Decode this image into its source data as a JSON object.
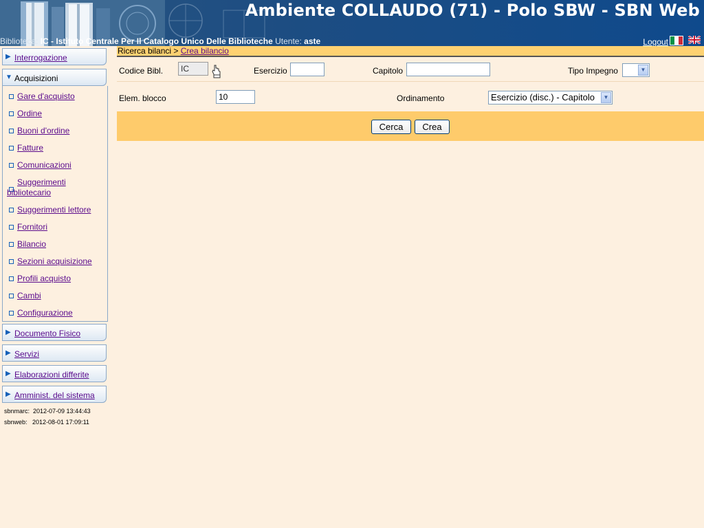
{
  "header": {
    "title": "Ambiente COLLAUDO (71) - Polo SBW - SBN Web",
    "biblioteca_label": "Biblioteca:",
    "biblioteca_value": "IC - Istituto Centrale Per Il Catalogo Unico Delle Biblioteche",
    "utente_label": "Utente:",
    "utente_value": "aste",
    "logout": "Logout"
  },
  "sidebar": {
    "interrogazione": "Interrogazione",
    "acquisizioni": "Acquisizioni",
    "items": [
      "Gare d'acquisto",
      "Ordine",
      "Buoni d'ordine",
      "Fatture",
      "Comunicazioni",
      "Suggerimenti",
      "bibliotecario",
      "Suggerimenti lettore",
      "Fornitori",
      "Bilancio",
      "Sezioni acquisizione",
      "Profili acquisto",
      "Cambi",
      "Configurazione"
    ],
    "documento_fisico": "Documento Fisico",
    "servizi": "Servizi",
    "elaborazioni": "Elaborazioni differite",
    "amministrazione": "Amminist. del sistema",
    "meta_sbnmarc": "sbnmarc:  2012-07-09 13:44:43",
    "meta_sbnweb": "sbnweb:   2012-08-01 17:09:11"
  },
  "breadcrumb": {
    "parent": "Ricerca bilanci",
    "separator": " > ",
    "current": "Crea bilancio"
  },
  "form": {
    "codice_bibl_label": "Codice Bibl.",
    "codice_bibl_value": "IC",
    "esercizio_label": "Esercizio",
    "esercizio_value": "",
    "capitolo_label": "Capitolo",
    "capitolo_value": "",
    "tipo_impegno_label": "Tipo Impegno",
    "tipo_impegno_value": "",
    "elem_blocco_label": "Elem. blocco",
    "elem_blocco_value": "10",
    "ordinamento_label": "Ordinamento",
    "ordinamento_value": "Esercizio (disc.) - Capitolo"
  },
  "buttons": {
    "cerca": "Cerca",
    "crea": "Crea"
  },
  "colors": {
    "header_bg": "#0f4a8c",
    "page_bg": "#fdf0e0",
    "breadcrumb_bg": "#fed171",
    "button_bar_bg": "#fecb6b",
    "link": "#5a0a8c"
  }
}
